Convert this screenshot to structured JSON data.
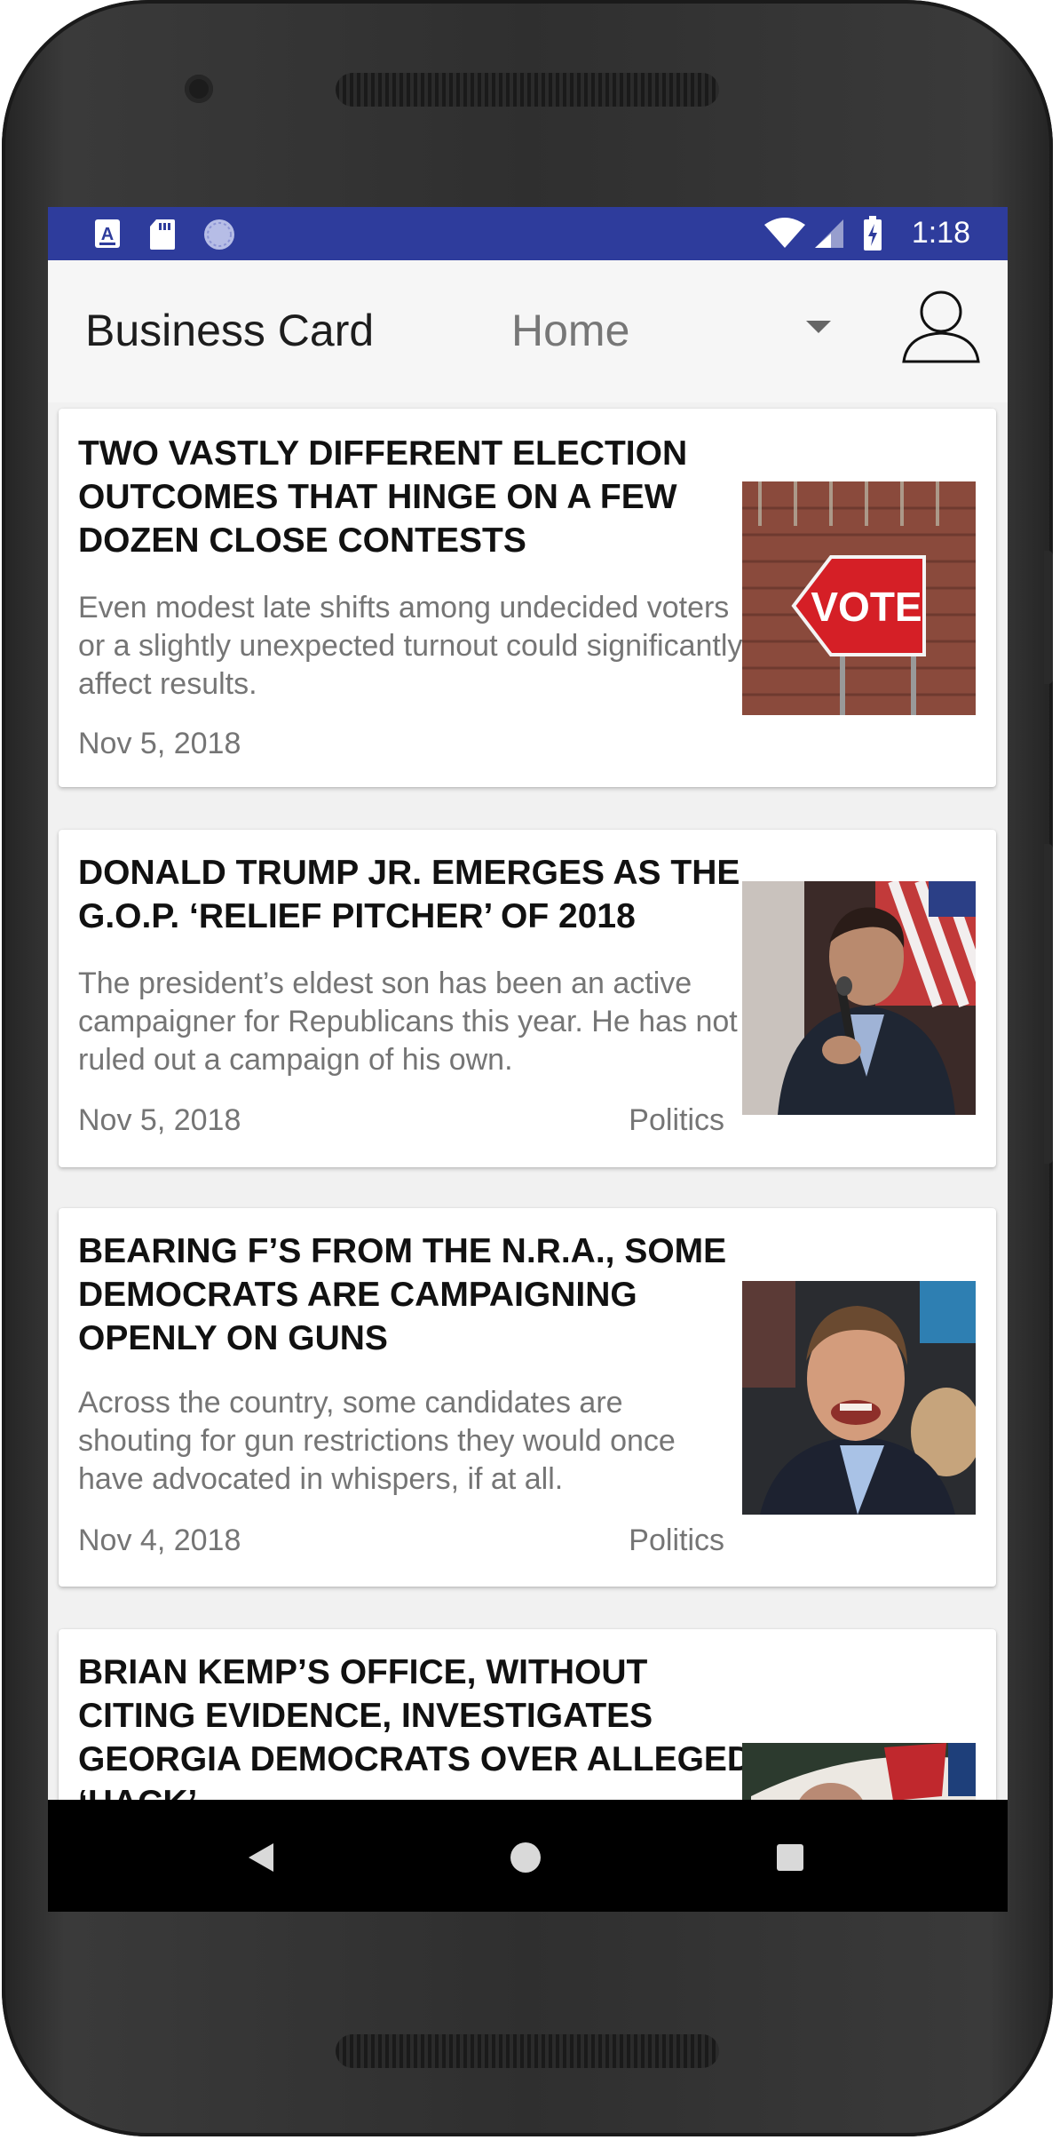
{
  "status_bar": {
    "time": "1:18",
    "left_icons": [
      "accessibility-a-icon",
      "sd-card-icon",
      "sync-circle-icon"
    ],
    "right_icons": [
      "wifi-icon",
      "signal-icon",
      "battery-charging-icon"
    ],
    "background": "#2e3c9c"
  },
  "app_bar": {
    "title": "Business Card",
    "spinner_value": "Home",
    "profile_icon": "person-outline-icon"
  },
  "articles": [
    {
      "title": "TWO VASTLY DIFFERENT ELECTION OUTCOMES THAT HINGE ON A FEW DOZEN CLOSE CONTESTS",
      "summary": "Even modest late shifts among undecided voters or a slightly unexpected turnout could significantly affect results.",
      "date": "Nov 5, 2018",
      "category": "",
      "image": "vote-sign-photo",
      "image_text": "VOTE"
    },
    {
      "title": "DONALD TRUMP JR. EMERGES AS THE G.O.P. ‘RELIEF PITCHER’ OF 2018",
      "summary": "The president’s eldest son has been an active campaigner for Republicans this year. He has not ruled out a campaign of his own.",
      "date": "Nov 5, 2018",
      "category": "Politics",
      "image": "speaker-with-microphone-photo"
    },
    {
      "title": "BEARING F’S FROM THE N.R.A., SOME DEMOCRATS ARE CAMPAIGNING OPENLY ON GUNS",
      "summary": "Across the country, some candidates are shouting for gun restrictions they would once have advocated in whispers, if at all.",
      "date": "Nov 4, 2018",
      "category": "Politics",
      "image": "smiling-candidate-photo"
    },
    {
      "title": "BRIAN KEMP’S OFFICE, WITHOUT CITING EVIDENCE, INVESTIGATES GEORGIA DEMOCRATS OVER ALLEGED ‘HACK’",
      "summary": "",
      "date": "",
      "category": "",
      "image": "newspaper-photo"
    }
  ],
  "nav_bar": {
    "back_icon": "back-triangle-icon",
    "home_icon": "home-circle-icon",
    "recents_icon": "recents-square-icon"
  }
}
